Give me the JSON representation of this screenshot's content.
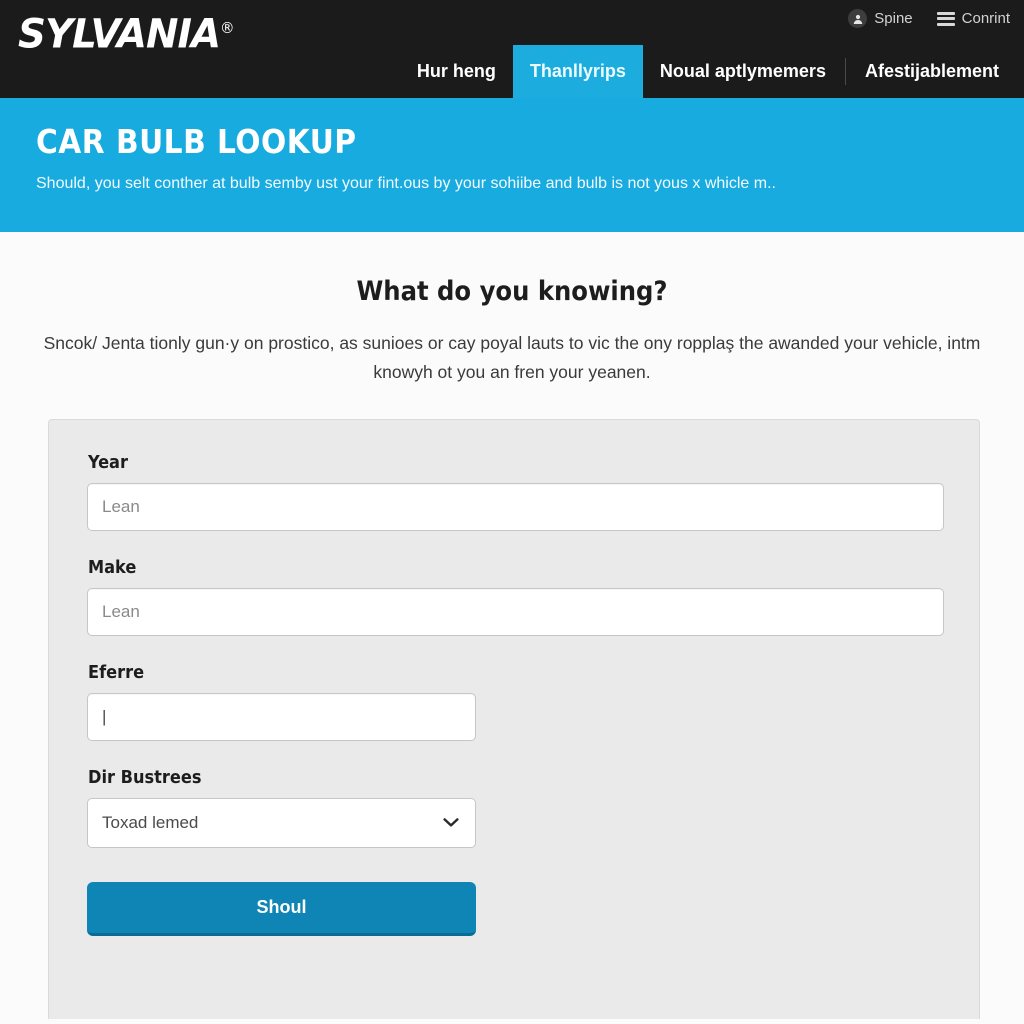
{
  "header": {
    "logo_text": "SYLVANIA",
    "logo_reg": "®",
    "util": [
      {
        "icon": "account-avatar-icon",
        "label": "Spine"
      },
      {
        "icon": "hamburger-menu-icon",
        "label": "Conrint"
      }
    ],
    "nav": [
      {
        "label": "Hur heng",
        "active": false
      },
      {
        "label": "Thanllyrips",
        "active": true
      },
      {
        "label": "Noual aptlymemers",
        "active": false
      },
      {
        "label": "Afestijablement",
        "active": false
      }
    ]
  },
  "hero": {
    "title": "CAR BULB LOOKUP",
    "subtitle": "Should, you selt conther at bulb semby ust your fint.ous by your sohiibe and bulb is not yous x whicle m.."
  },
  "intro": {
    "title": "What do you knowing?",
    "text": "Sncok/ Jenta tionly gun·y on prostico, as sunioes or cay poyal lauts to vic the ony ropplaş the awanded your vehicle, intm knowyh ot you an fren your yeanen."
  },
  "form": {
    "fields": [
      {
        "label": "Year",
        "placeholder": "Lean",
        "value": "",
        "type": "text",
        "width": "wide"
      },
      {
        "label": "Make",
        "placeholder": "Lean",
        "value": "",
        "type": "text",
        "width": "wide"
      },
      {
        "label": "Eferre",
        "placeholder": "",
        "value": "|",
        "type": "text",
        "width": "narrow"
      },
      {
        "label": "Dir Bustrees",
        "placeholder": "",
        "value": "Toxad lemed",
        "type": "select",
        "width": "narrow"
      }
    ],
    "submit_label": "Shoul"
  },
  "colors": {
    "header_bg": "#1b1b1b",
    "brand_cyan": "#17abdf",
    "active_tab": "#1cadde",
    "button_blue": "#0e85b5",
    "card_bg": "#eaeaea",
    "page_bg": "#fbfbfb"
  }
}
